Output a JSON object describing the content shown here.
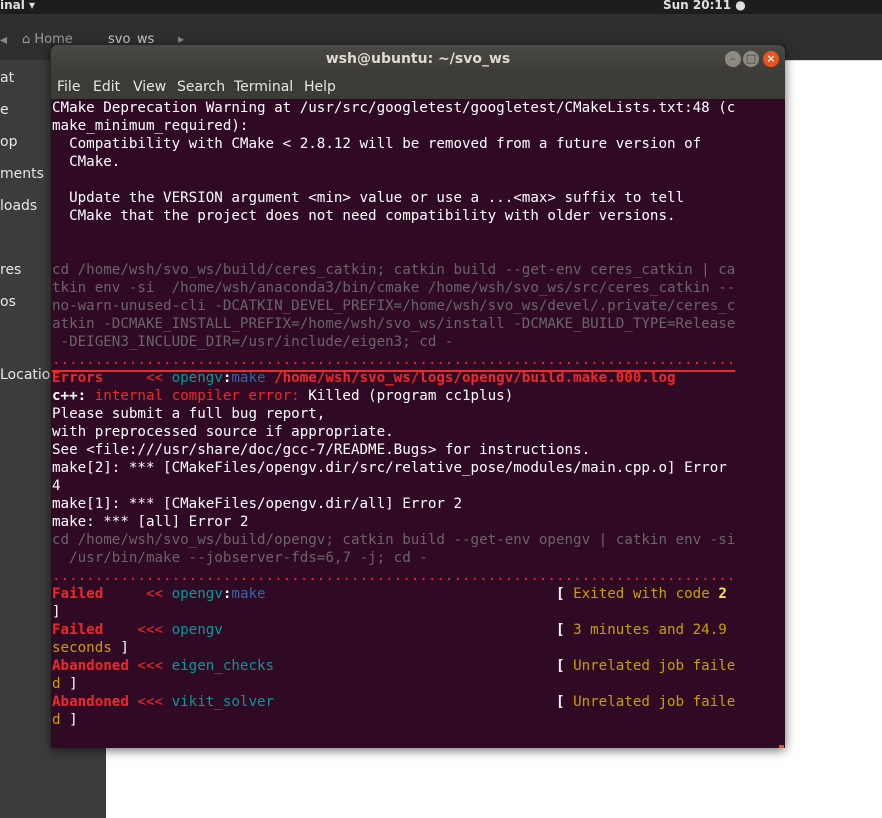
{
  "topbar": {
    "app": "inal ▾",
    "clock": "Sun 20:11 ●"
  },
  "nautilus": {
    "crumbs": {
      "home": "⌂ Home",
      "svo": "svo_ws"
    },
    "sidebar": [
      "at",
      "e",
      "op",
      "ments",
      "loads",
      "",
      "res",
      "os",
      "Locatio"
    ]
  },
  "terminal": {
    "title": "wsh@ubuntu: ~/svo_ws",
    "menu": [
      "File",
      "Edit",
      "View",
      "Search",
      "Terminal",
      "Help"
    ],
    "lines": [
      "CMake Deprecation Warning at /usr/src/googletest/googletest/CMakeLists.txt:48 (c",
      "make_minimum_required):",
      "  Compatibility with CMake < 2.8.12 will be removed from a future version of",
      "  CMake.",
      "",
      "  Update the VERSION argument <min> value or use a ...<max> suffix to tell",
      "  CMake that the project does not need compatibility with older versions.",
      "",
      "",
      "cd /home/wsh/svo_ws/build/ceres_catkin; catkin build --get-env ceres_catkin | ca",
      "tkin env -si  /home/wsh/anaconda3/bin/cmake /home/wsh/svo_ws/src/ceres_catkin --",
      "no-warn-unused-cli -DCATKIN_DEVEL_PREFIX=/home/wsh/svo_ws/devel/.private/ceres_c",
      "atkin -DCMAKE_INSTALL_PREFIX=/home/wsh/svo_ws/install -DCMAKE_BUILD_TYPE=Release",
      " -DEIGEN3_INCLUDE_DIR=/usr/include/eigen3; cd -",
      "................................................................................",
      "Errors     << opengv:make /home/wsh/svo_ws/logs/opengv/build.make.000.log",
      "c++: internal compiler error: Killed (program cc1plus)",
      "Please submit a full bug report,",
      "with preprocessed source if appropriate.",
      "See <file:///usr/share/doc/gcc-7/README.Bugs> for instructions.",
      "make[2]: *** [CMakeFiles/opengv.dir/src/relative_pose/modules/main.cpp.o] Error",
      "4",
      "make[1]: *** [CMakeFiles/opengv.dir/all] Error 2",
      "make: *** [all] Error 2",
      "cd /home/wsh/svo_ws/build/opengv; catkin build --get-env opengv | catkin env -si",
      "  /usr/bin/make --jobserver-fds=6,7 -j; cd -",
      "................................................................................",
      "Failed     << opengv:make                                  [ Exited with code 2",
      "]",
      "Failed    <<< opengv                                       [ 3 minutes and 24.9",
      "seconds ]",
      "Abandoned <<< eigen_checks                                 [ Unrelated job faile",
      "d ]",
      "Abandoned <<< vikit_solver                                 [ Unrelated job faile",
      "d ]"
    ]
  },
  "colors": {
    "terminal_bg": "#300a24",
    "error_red": "#ef2929",
    "cyan": "#06989a",
    "blue": "#3465a4",
    "yellow": "#c4a000",
    "accent_orange": "#e95420"
  }
}
